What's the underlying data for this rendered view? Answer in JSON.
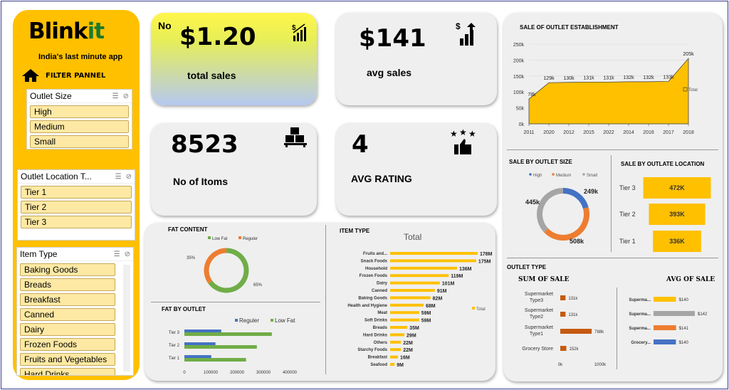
{
  "brand": {
    "name_a": "Blink",
    "name_b": "it",
    "tagline": "India's last minute app",
    "filter_title": "FILTER PANNEL"
  },
  "slicers": {
    "outlet_size": {
      "title": "Outlet Size",
      "items": [
        "High",
        "Medium",
        "Small"
      ]
    },
    "outlet_location": {
      "title": "Outlet Location T...",
      "items": [
        "Tier 1",
        "Tier 2",
        "Tier 3"
      ]
    },
    "item_type": {
      "title": "Item Type",
      "items": [
        "Baking Goods",
        "Breads",
        "Breakfast",
        "Canned",
        "Dairy",
        "Frozen Foods",
        "Fruits and Vegetables",
        "Hard Drinks"
      ]
    }
  },
  "kpis": {
    "total_sales": {
      "prefix": "No",
      "value": "$1.20",
      "label": "total sales"
    },
    "avg_sales": {
      "value": "$141",
      "label": "avg sales"
    },
    "items": {
      "value": "8523",
      "label": "No of Itoms"
    },
    "rating": {
      "value": "4",
      "label": "AVG RATING"
    }
  },
  "icons": [
    "money-chart-icon",
    "dollar-chart-icon",
    "boxes-icon",
    "stars-thumb-icon",
    "home-icon",
    "filter-list-icon",
    "clear-filter-icon"
  ],
  "colors": {
    "accent": "#ffc000",
    "high": "#4472c4",
    "medium": "#ed7d31",
    "small": "#a5a5a5",
    "green": "#70ad47"
  },
  "chart_data": [
    {
      "id": "establishment",
      "type": "area",
      "title": "SALE OF OUTLET ESTABLISHMENT",
      "categories": [
        "2011",
        "2020",
        "2012",
        "2015",
        "2022",
        "2014",
        "2016",
        "2017",
        "2018"
      ],
      "values": [
        78,
        129,
        130,
        131,
        131,
        132,
        132,
        133,
        205
      ],
      "labels": [
        "78k",
        "129k",
        "130k",
        "131k",
        "131k",
        "132k",
        "132k",
        "133k",
        "205k"
      ],
      "yticks": [
        "0k",
        "50k",
        "100k",
        "150k",
        "200k",
        "250k"
      ],
      "ylim": [
        0,
        250
      ],
      "legend": "Total"
    },
    {
      "id": "fat",
      "type": "pie",
      "title": "FAT CONTENT",
      "series": [
        {
          "name": "Low Fat",
          "value": 65,
          "label": "65%",
          "color": "#70ad47"
        },
        {
          "name": "Reguler",
          "value": 35,
          "label": "35%",
          "color": "#ed7d31"
        }
      ]
    },
    {
      "id": "fat_outlet",
      "type": "bar",
      "title": "FAT BY OUTLET",
      "categories": [
        "Tier 3",
        "Tier 2",
        "Tier 1"
      ],
      "series": [
        {
          "name": "Reguler",
          "values": [
            140000,
            118000,
            102000
          ]
        },
        {
          "name": "Low Fat",
          "values": [
            332000,
            275000,
            234000
          ]
        }
      ],
      "xticks": [
        "0",
        "100000",
        "200000",
        "300000",
        "400000"
      ],
      "xlim": [
        0,
        400000
      ]
    },
    {
      "id": "item_type",
      "type": "bar",
      "title": "ITEM TYPE",
      "subtitle": "Total",
      "legend": "Total",
      "categories": [
        "Fruits and...",
        "Snack Foods",
        "Household",
        "Frozen Foods",
        "Dairy",
        "Canned",
        "Baking Goods",
        "Health and Hygiene",
        "Meat",
        "Soft Drinks",
        "Breads",
        "Hard Drinks",
        "Others",
        "Starchy Foods",
        "Breakfast",
        "Seafood"
      ],
      "values": [
        178,
        175,
        136,
        119,
        101,
        91,
        82,
        68,
        59,
        59,
        35,
        29,
        22,
        22,
        16,
        9
      ],
      "labels": [
        "178M",
        "175M",
        "136M",
        "119M",
        "101M",
        "91M",
        "82M",
        "68M",
        "59M",
        "59M",
        "35M",
        "29M",
        "22M",
        "22M",
        "16M",
        "9M"
      ]
    },
    {
      "id": "outlet_size",
      "type": "pie",
      "title": "SALE BY OUTLET SIZE",
      "series": [
        {
          "name": "High",
          "value": 249,
          "label": "249k",
          "color": "#4472c4"
        },
        {
          "name": "Medium",
          "value": 508,
          "label": "508k",
          "color": "#ed7d31"
        },
        {
          "name": "Small",
          "value": 445,
          "label": "445k",
          "color": "#a5a5a5"
        }
      ]
    },
    {
      "id": "location",
      "type": "bar",
      "title": "SALE BY OUTLATE LOCATION",
      "categories": [
        "Tier 3",
        "Tier 2",
        "Tier 1"
      ],
      "values": [
        472,
        393,
        336
      ],
      "labels": [
        "472K",
        "393K",
        "336K"
      ]
    },
    {
      "id": "outlet_type_sum",
      "type": "bar",
      "title": "SUM OF SALE",
      "categories": [
        "Supermarket Type3",
        "Supermarket Type2",
        "Supermarket Type1",
        "Grocery Store"
      ],
      "values": [
        131,
        131,
        788,
        152
      ],
      "labels": [
        "131k",
        "131k",
        "788k",
        "152k"
      ],
      "xticks": [
        "0k",
        "1000k"
      ],
      "xlim": [
        0,
        1000
      ]
    },
    {
      "id": "outlet_type_avg",
      "type": "bar",
      "title": "AVG OF SALE",
      "categories": [
        "Superma...",
        "Superma...",
        "Superma...",
        "Grocery..."
      ],
      "values": [
        140,
        142,
        141,
        140
      ],
      "labels": [
        "$140",
        "$142",
        "$141",
        "$140"
      ],
      "colors": [
        "#ffc000",
        "#a5a5a5",
        "#ed7d31",
        "#4472c4"
      ]
    }
  ],
  "section_titles": {
    "outlet_type": "OUTLET TYPE"
  }
}
